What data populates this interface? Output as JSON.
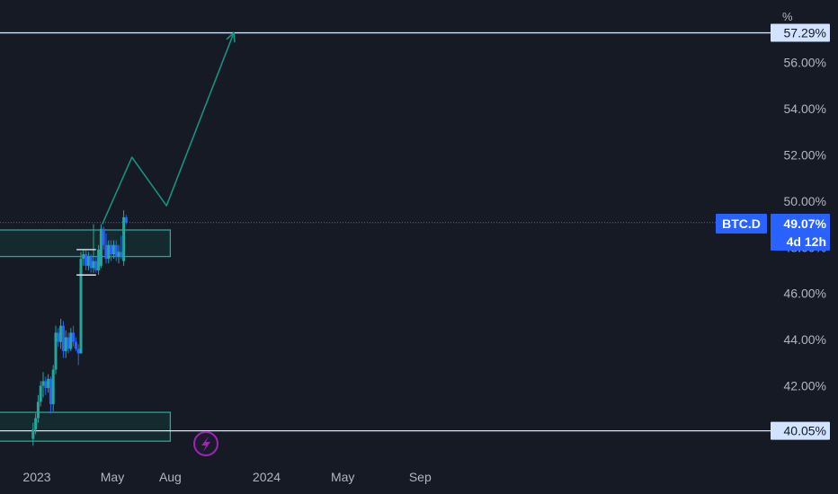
{
  "chart_data": {
    "type": "candlestick",
    "symbol": "BTC.D",
    "unit": "%",
    "current_value": "49.07%",
    "countdown": "4d 12h",
    "y_axis": {
      "ticks": [
        42,
        44,
        46,
        48,
        50,
        52,
        54,
        56
      ],
      "tick_labels": [
        "42.00%",
        "44.00%",
        "46.00%",
        "48.00%",
        "50.00%",
        "52.00%",
        "54.00%",
        "56.00%"
      ],
      "range": [
        38.2,
        58.7
      ]
    },
    "x_axis": {
      "labels": [
        {
          "text": "2023",
          "date": "2023-01"
        },
        {
          "text": "May",
          "date": "2023-05"
        },
        {
          "text": "Aug",
          "date": "2023-08"
        },
        {
          "text": "2024",
          "date": "2024-01"
        },
        {
          "text": "May",
          "date": "2024-05"
        },
        {
          "text": "Sep",
          "date": "2024-09"
        }
      ]
    },
    "horizontal_lines": [
      {
        "value": 57.29,
        "label": "57.29%"
      },
      {
        "value": 40.05,
        "label": "40.05%"
      }
    ],
    "zones": [
      {
        "from": 47.6,
        "to": 48.75,
        "start": "2022-10",
        "end": "2023-08"
      },
      {
        "from": 39.6,
        "to": 40.85,
        "start": "2022-10",
        "end": "2023-08"
      }
    ],
    "projection_path": [
      {
        "date": "2023-04-15",
        "value": 49.0
      },
      {
        "date": "2023-06-01",
        "value": 51.9
      },
      {
        "date": "2023-07-26",
        "value": 49.8
      },
      {
        "date": "2023-11-10",
        "value": 57.3
      }
    ],
    "range_markers": [
      {
        "low": 46.8,
        "high": 47.9,
        "start": "2023-03-05",
        "end": "2023-04-05"
      }
    ],
    "candles": [
      {
        "date": "2022-12-26",
        "open": 39.7,
        "high": 40.4,
        "low": 39.4,
        "close": 40.1
      },
      {
        "date": "2022-12-30",
        "open": 40.1,
        "high": 40.8,
        "low": 39.9,
        "close": 40.6
      },
      {
        "date": "2023-01-03",
        "open": 40.6,
        "high": 41.6,
        "low": 40.4,
        "close": 41.3
      },
      {
        "date": "2023-01-07",
        "open": 41.3,
        "high": 42.2,
        "low": 41.1,
        "close": 42.0
      },
      {
        "date": "2023-01-11",
        "open": 42.0,
        "high": 42.6,
        "low": 41.5,
        "close": 42.2
      },
      {
        "date": "2023-01-15",
        "open": 42.2,
        "high": 42.4,
        "low": 41.6,
        "close": 41.9
      },
      {
        "date": "2023-01-19",
        "open": 41.9,
        "high": 42.5,
        "low": 41.7,
        "close": 42.3
      },
      {
        "date": "2023-01-23",
        "open": 42.3,
        "high": 42.4,
        "low": 40.8,
        "close": 41.2
      },
      {
        "date": "2023-01-27",
        "open": 41.2,
        "high": 42.9,
        "low": 40.9,
        "close": 42.7
      },
      {
        "date": "2023-01-31",
        "open": 42.7,
        "high": 44.6,
        "low": 42.5,
        "close": 44.3
      },
      {
        "date": "2023-02-04",
        "open": 44.3,
        "high": 44.5,
        "low": 43.7,
        "close": 43.9
      },
      {
        "date": "2023-02-08",
        "open": 43.9,
        "high": 44.9,
        "low": 43.6,
        "close": 44.6
      },
      {
        "date": "2023-02-12",
        "open": 44.6,
        "high": 44.8,
        "low": 43.2,
        "close": 43.5
      },
      {
        "date": "2023-02-16",
        "open": 43.5,
        "high": 44.4,
        "low": 43.2,
        "close": 44.1
      },
      {
        "date": "2023-02-20",
        "open": 44.1,
        "high": 44.3,
        "low": 43.4,
        "close": 43.6
      },
      {
        "date": "2023-02-24",
        "open": 43.6,
        "high": 44.5,
        "low": 43.5,
        "close": 44.3
      },
      {
        "date": "2023-02-28",
        "open": 44.3,
        "high": 44.6,
        "low": 43.7,
        "close": 43.9
      },
      {
        "date": "2023-03-04",
        "open": 43.9,
        "high": 44.1,
        "low": 43.5,
        "close": 43.6
      },
      {
        "date": "2023-03-08",
        "open": 43.6,
        "high": 43.8,
        "low": 42.9,
        "close": 43.4
      },
      {
        "date": "2023-03-12",
        "open": 43.4,
        "high": 47.8,
        "low": 43.4,
        "close": 47.5
      },
      {
        "date": "2023-03-16",
        "open": 47.5,
        "high": 47.9,
        "low": 47.2,
        "close": 47.7
      },
      {
        "date": "2023-03-20",
        "open": 47.7,
        "high": 47.9,
        "low": 47.0,
        "close": 47.2
      },
      {
        "date": "2023-03-24",
        "open": 47.2,
        "high": 47.8,
        "low": 47.0,
        "close": 47.6
      },
      {
        "date": "2023-03-28",
        "open": 47.6,
        "high": 47.7,
        "low": 46.9,
        "close": 47.1
      },
      {
        "date": "2023-04-01",
        "open": 47.1,
        "high": 49.0,
        "low": 46.9,
        "close": 47.4
      },
      {
        "date": "2023-04-05",
        "open": 47.4,
        "high": 47.6,
        "low": 46.9,
        "close": 47.0
      },
      {
        "date": "2023-04-09",
        "open": 47.0,
        "high": 48.1,
        "low": 46.8,
        "close": 47.9
      },
      {
        "date": "2023-04-13",
        "open": 47.2,
        "high": 49.0,
        "low": 47.1,
        "close": 48.8
      },
      {
        "date": "2023-04-17",
        "open": 48.8,
        "high": 48.9,
        "low": 47.9,
        "close": 48.1
      },
      {
        "date": "2023-04-21",
        "open": 48.1,
        "high": 48.6,
        "low": 47.3,
        "close": 47.5
      },
      {
        "date": "2023-04-25",
        "open": 47.5,
        "high": 48.3,
        "low": 47.3,
        "close": 48.1
      },
      {
        "date": "2023-04-29",
        "open": 48.1,
        "high": 48.3,
        "low": 47.4,
        "close": 47.7
      },
      {
        "date": "2023-05-03",
        "open": 47.7,
        "high": 48.3,
        "low": 47.5,
        "close": 48.1
      },
      {
        "date": "2023-05-07",
        "open": 48.1,
        "high": 48.3,
        "low": 47.4,
        "close": 47.6
      },
      {
        "date": "2023-05-11",
        "open": 47.6,
        "high": 48.1,
        "low": 47.3,
        "close": 47.8
      },
      {
        "date": "2023-05-15",
        "open": 47.8,
        "high": 48.5,
        "low": 47.5,
        "close": 47.6
      },
      {
        "date": "2023-05-19",
        "open": 47.4,
        "high": 49.6,
        "low": 47.2,
        "close": 49.3
      },
      {
        "date": "2023-05-23",
        "open": 49.3,
        "high": 49.4,
        "low": 49.0,
        "close": 49.07
      }
    ],
    "colors": {
      "background": "#161a25",
      "up": "#26a69a",
      "down": "#2962ff",
      "axis_text": "#b2b5be",
      "zone_border": "#26a69a",
      "zone_fill": "#163033",
      "horizontal_line": "#d1e3ff",
      "projection": "#179281",
      "range_marker": "#d1d4dc",
      "badge": "#2962ff",
      "current_line": "#4f6fb5",
      "event_icon": "#9c27b0"
    }
  },
  "icons": {
    "event": "lightning-icon"
  }
}
